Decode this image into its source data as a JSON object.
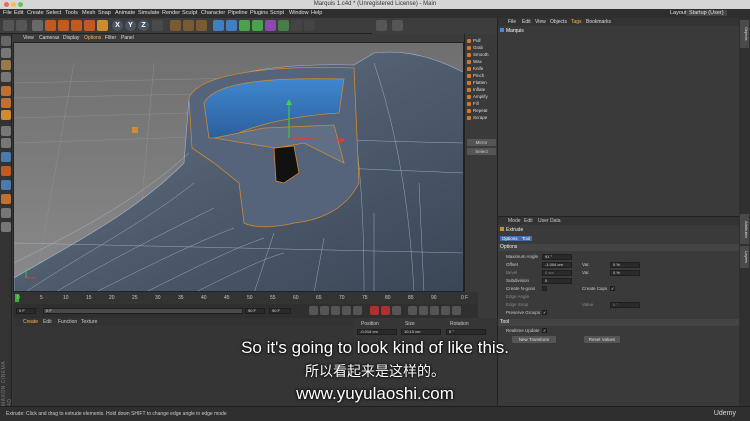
{
  "window": {
    "title": "Marquis 1.c4d * (Unregistered License) - Main"
  },
  "menubar": {
    "items": [
      "File",
      "Edit",
      "Create",
      "Select",
      "Tools",
      "Mesh",
      "Snap",
      "Animate",
      "Simulate",
      "Render",
      "Sculpt",
      "Character",
      "Pipeline",
      "Plugins",
      "Script",
      "Window",
      "Help"
    ],
    "layout_label": "Layout:",
    "layout_value": "Startup (User)"
  },
  "toolbar": {
    "x_label": "X",
    "y_label": "Y",
    "z_label": "Z"
  },
  "viewport": {
    "menu": [
      "View",
      "Cameras",
      "Display",
      "Options",
      "Filter",
      "Panel"
    ]
  },
  "sculpt_brushes": {
    "items": [
      "Pull",
      "Grab",
      "Smooth",
      "Wax",
      "Knife",
      "Pinch",
      "Flatten",
      "Inflate",
      "Amplify",
      "Fill",
      "Repeat",
      "Scrape"
    ],
    "buttons": [
      "Mirror",
      "Select"
    ]
  },
  "timeline": {
    "ticks": [
      "0",
      "5",
      "10",
      "15",
      "20",
      "25",
      "30",
      "35",
      "40",
      "45",
      "50",
      "55",
      "60",
      "65",
      "70",
      "75",
      "80",
      "85",
      "90"
    ],
    "end_label": "0 F",
    "current_frame": "0 F",
    "start_field": "0 F",
    "end_field": "90 F",
    "max_field": "90 F"
  },
  "material_manager": {
    "menu": [
      "Create",
      "Edit",
      "Function",
      "Texture"
    ],
    "side_label": "MAXON CINEMA 4D"
  },
  "coordinates": {
    "headers": [
      "Position",
      "Size",
      "Rotation"
    ],
    "x_pos": "-0.014 cm",
    "x_size": "10.10 cm",
    "x_rot": "0 °"
  },
  "object_manager": {
    "menu": [
      "File",
      "Edit",
      "View",
      "Objects",
      "Tags",
      "Bookmarks"
    ],
    "object_name": "Marquis"
  },
  "attribute_manager": {
    "menu": [
      "Mode",
      "Edit",
      "User Data"
    ],
    "tool_name": "Extrude",
    "tabs": [
      "Options",
      "Tool"
    ],
    "section_options": "Options",
    "max_angle_label": "Maximum Angle",
    "max_angle_value": "91 °",
    "offset_label": "Offset",
    "offset_value": "-1.004 cm",
    "var1_label": "Var.",
    "var1_value": "0 %",
    "bevel_label": "Bevel",
    "bevel_value": "0 cm",
    "var2_label": "Var.",
    "var2_value": "0 %",
    "subdivision_label": "Subdivision",
    "subdivision_value": "0",
    "create_ngons_label": "Create N-gons",
    "create_caps_label": "Create Caps",
    "edge_angle_label": "Edge Angle",
    "edge_snap_label": "Edge Snap",
    "value_label": "Value",
    "value_value": "0 °",
    "preserve_groups_label": "Preserve Groups",
    "section_tool": "Tool",
    "realtime_label": "Realtime Update",
    "new_transform": "New Transform",
    "reset_values": "Reset Values"
  },
  "right_tabs": [
    "Objects",
    "Attributes",
    "Layers"
  ],
  "statusbar": {
    "text": "Extrude: Click and drag to extrude elements. Hold down SHIFT to change edge angle in edge mode",
    "brand": "Udemy"
  },
  "subtitles": {
    "english": "So it's going to look kind of like this.",
    "chinese": "所以看起来是这样的。",
    "url": "www.yuyulaoshi.com"
  }
}
